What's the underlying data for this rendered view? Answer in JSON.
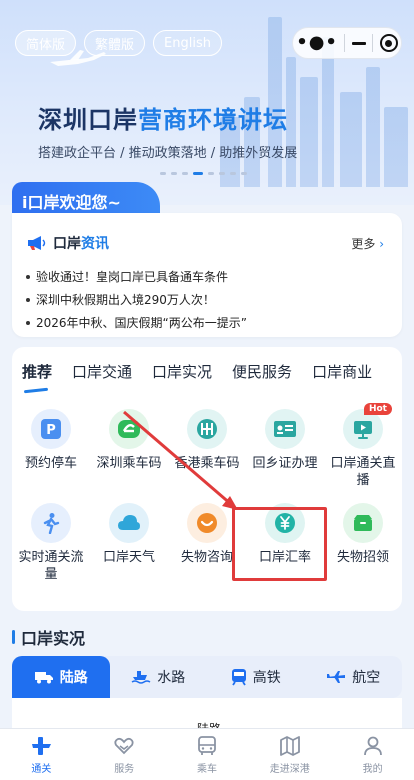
{
  "languages": [
    {
      "label": "简体版",
      "active": true
    },
    {
      "label": "繁體版",
      "active": false
    },
    {
      "label": "English",
      "active": false
    }
  ],
  "banner": {
    "title_main": "深圳口岸",
    "title_highlight": "营商环境讲坛",
    "subtitle": "搭建政企平台 / 推动政策落地 / 助推外贸发展"
  },
  "welcome": {
    "title": "i口岸欢迎您~",
    "news_title_main": "口岸",
    "news_title_highlight": "资讯",
    "more": "更多",
    "items": [
      "验收通过！皇岗口岸已具备通车条件",
      "深圳中秋假期出入境290万人次！",
      "2026年中秋、国庆假期“两公布一提示”"
    ]
  },
  "categories": [
    "推荐",
    "口岸交通",
    "口岸实况",
    "便民服务",
    "口岸商业"
  ],
  "services": [
    {
      "label": "预约停车",
      "icon": "parking-icon",
      "color": "#4a8ff0",
      "bg": "#e6effd"
    },
    {
      "label": "深圳乘车码",
      "icon": "shenzhen-bus-code-icon",
      "color": "#2fba5a",
      "bg": "#e3f6e9"
    },
    {
      "label": "香港乘车码",
      "icon": "hk-metro-icon",
      "color": "#2aa6a0",
      "bg": "#e1f4f3"
    },
    {
      "label": "回乡证办理",
      "icon": "id-card-icon",
      "color": "#2aa6a0",
      "bg": "#e1f4f3"
    },
    {
      "label": "口岸通关直播",
      "icon": "live-broadcast-icon",
      "color": "#2aa6a0",
      "bg": "#e1f4f3",
      "badge": "Hot"
    },
    {
      "label": "实时通关流量",
      "icon": "walking-person-icon",
      "color": "#4a8ff0",
      "bg": "#e6effd"
    },
    {
      "label": "口岸天气",
      "icon": "cloud-icon",
      "color": "#2fa6d9",
      "bg": "#e1f1fa"
    },
    {
      "label": "失物咨询",
      "icon": "chat-icon",
      "color": "#f08a2a",
      "bg": "#fdeee0"
    },
    {
      "label": "口岸汇率",
      "icon": "yuan-icon",
      "color": "#22b3a6",
      "bg": "#dff4f2"
    },
    {
      "label": "失物招领",
      "icon": "box-icon",
      "color": "#2fba5a",
      "bg": "#e3f6e9"
    }
  ],
  "port_status": {
    "title": "口岸实况",
    "tabs": [
      {
        "label": "陆路",
        "icon": "truck-icon",
        "active": true
      },
      {
        "label": "水路",
        "icon": "ship-icon",
        "active": false
      },
      {
        "label": "高铁",
        "icon": "train-icon",
        "active": false
      },
      {
        "label": "航空",
        "icon": "plane-icon",
        "active": false
      }
    ],
    "panel_label": "陆路"
  },
  "bottom_nav": [
    {
      "label": "通关",
      "icon": "checkpoint-icon",
      "active": true
    },
    {
      "label": "服务",
      "icon": "heart-hands-icon",
      "active": false
    },
    {
      "label": "乘车",
      "icon": "bus-icon",
      "active": false
    },
    {
      "label": "走进深港",
      "icon": "map-icon",
      "active": false
    },
    {
      "label": "我的",
      "icon": "user-icon",
      "active": false
    }
  ]
}
